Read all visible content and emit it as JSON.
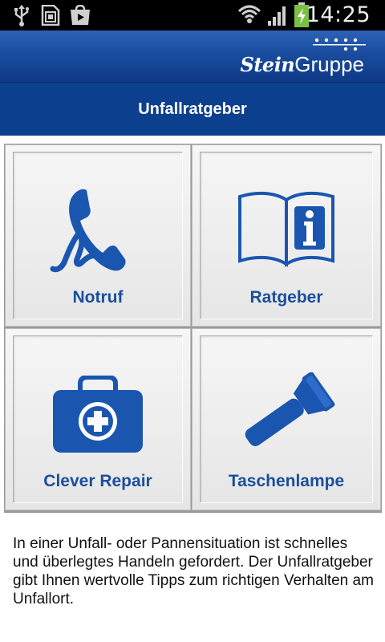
{
  "status_bar": {
    "time": "14:25",
    "icons": [
      "usb-icon",
      "sd-card-icon",
      "play-store-icon",
      "wifi-icon",
      "signal-icon",
      "battery-charging-icon"
    ]
  },
  "brand": {
    "logo_part1": "Stein",
    "logo_part2": "Gruppe"
  },
  "header": {
    "title": "Unfallratgeber"
  },
  "tiles": [
    {
      "label": "Notruf",
      "icon": "phone-icon"
    },
    {
      "label": "Ratgeber",
      "icon": "info-book-icon"
    },
    {
      "label": "Clever Repair",
      "icon": "first-aid-kit-icon"
    },
    {
      "label": "Taschenlampe",
      "icon": "flashlight-icon"
    }
  ],
  "description": "In einer Unfall- oder Pannensituation ist schnelles und überlegtes Handeln gefordert. Der Unfallratgeber gibt Ihnen wertvolle Tipps zum richtigen Verhalten am Unfallort.",
  "colors": {
    "accent": "#1a4f9c",
    "title_bar": "#0d3f8f",
    "status_bar": "#000000"
  }
}
